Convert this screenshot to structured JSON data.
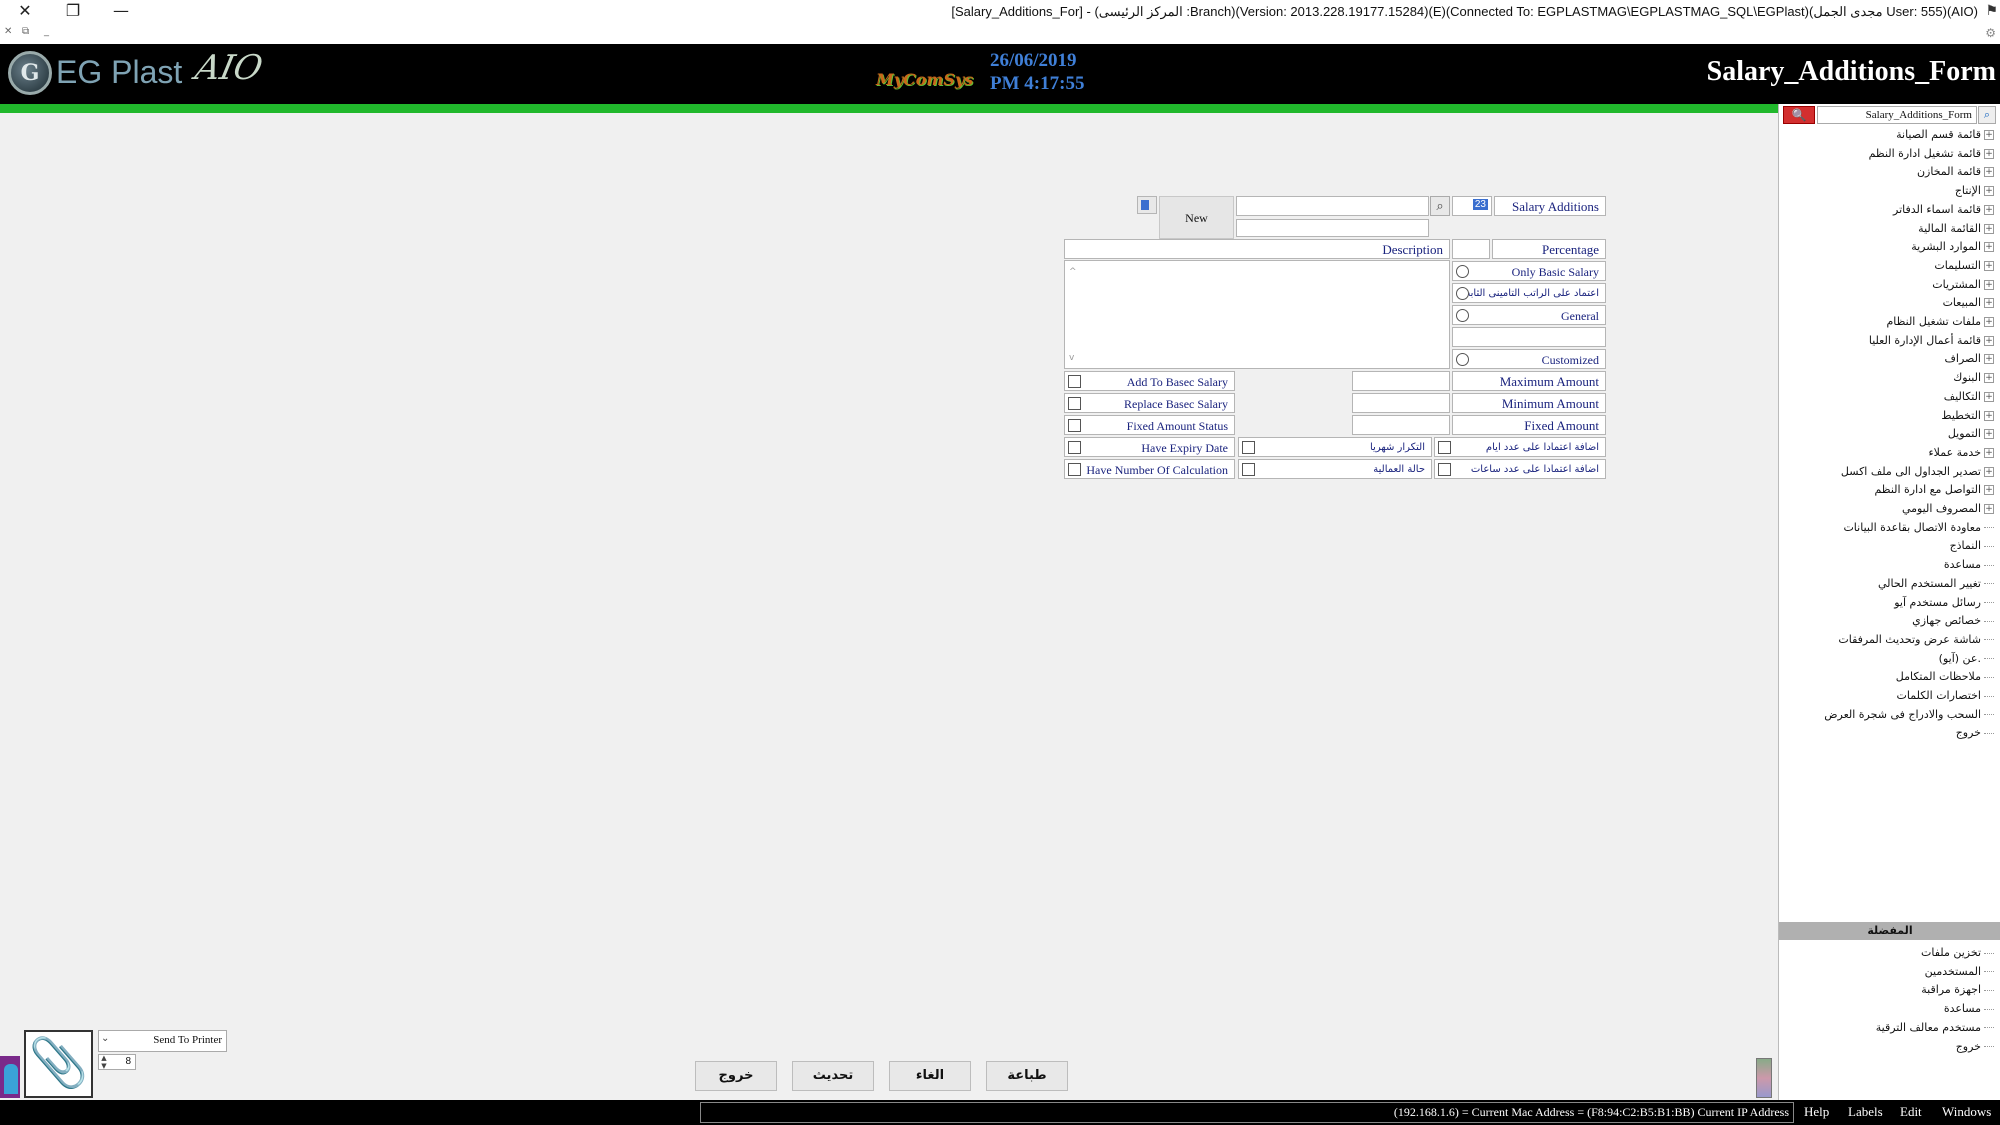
{
  "window": {
    "title": "[Salary_Additions_For] - (المركز الرئيسى :Branch)(Version: 2013.228.19177.15284)(E)(Connected To: EGPLASTMAG\\EGPLASTMAG_SQL\\EGPlast)(مجدى الجمل User: 555)(AIO)"
  },
  "header": {
    "logo_text": "EG Plast",
    "logo_suffix": "AIO",
    "vendor": "MyComSys",
    "date": "26/06/2019",
    "time": "PM 4:17:55",
    "form_title": "Salary_Additions_Form"
  },
  "form": {
    "record_label": "Salary Additions",
    "record_id": "23",
    "name_value": "",
    "name2_value": "",
    "new_button": "New",
    "percentage_label": "Percentage",
    "description_label": "Description",
    "radios": {
      "only_basic": "Only Basic Salary",
      "insurance": "اعتماد على الراتب التامينى الثابت",
      "general": "General",
      "customized": "Customized"
    },
    "amounts": {
      "maximum": "Maximum Amount",
      "minimum": "Minimum Amount",
      "fixed": "Fixed Amount"
    },
    "checks": {
      "add_to_basic": "Add To Basec Salary",
      "replace_basic": "Replace Basec Salary",
      "fixed_status": "Fixed Amount Status",
      "expiry": "Have Expiry Date",
      "num_calc": "Have Number Of Calculation",
      "monthly_repeat": "التكرار شهريا",
      "attendance": "حالة العمالية",
      "by_days": "اضافة اعتمادا على عدد ايام",
      "by_hours": "اضافة اعتمادا على عدد ساعات"
    }
  },
  "actions": {
    "print": "طباعة",
    "cancel": "الغاء",
    "update": "تحديث",
    "exit": "خروج"
  },
  "printer": {
    "mode": "Send To Printer",
    "copies": "8"
  },
  "statusbar": {
    "ip_text": "(192.168.1.6) = Current Mac Address = (F8:94:C2:B5:B1:BB) Current IP Address",
    "menus": [
      "Help",
      "Labels",
      "Edit",
      "Windows"
    ]
  },
  "right_panel": {
    "search_value": "Salary_Additions_Form",
    "tree": [
      {
        "label": "قائمة قسم الصيانة",
        "expandable": true
      },
      {
        "label": "قائمة تشغيل ادارة النظم",
        "expandable": true
      },
      {
        "label": "قائمة المخازن",
        "expandable": true
      },
      {
        "label": "الإنتاج",
        "expandable": true
      },
      {
        "label": "قائمة اسماء الدفاتر",
        "expandable": true
      },
      {
        "label": "القائمة المالية",
        "expandable": true
      },
      {
        "label": "الموارد البشرية",
        "expandable": true
      },
      {
        "label": "التسليمات",
        "expandable": true
      },
      {
        "label": "المشتريات",
        "expandable": true
      },
      {
        "label": "المبيعات",
        "expandable": true
      },
      {
        "label": "ملفات تشغيل النظام",
        "expandable": true
      },
      {
        "label": "قائمة أعمال الإدارة العليا",
        "expandable": true
      },
      {
        "label": "الصراف",
        "expandable": true
      },
      {
        "label": "البنوك",
        "expandable": true
      },
      {
        "label": "التكاليف",
        "expandable": true
      },
      {
        "label": "التخطيط",
        "expandable": true
      },
      {
        "label": "التمويل",
        "expandable": true
      },
      {
        "label": "خدمة عملاء",
        "expandable": true
      },
      {
        "label": "تصدير الجداول الى ملف اكسل",
        "expandable": true
      },
      {
        "label": "التواصل مع ادارة النظم",
        "expandable": true
      },
      {
        "label": "المصروف اليومي",
        "expandable": true
      },
      {
        "label": "معاودة الاتصال بقاعدة البيانات",
        "expandable": false
      },
      {
        "label": "النماذج",
        "expandable": false
      },
      {
        "label": "مساعدة",
        "expandable": false
      },
      {
        "label": "تغيير المستخدم الحالي",
        "expandable": false
      },
      {
        "label": "رسائل مستخدم آيو",
        "expandable": false
      },
      {
        "label": "خصائص جهازي",
        "expandable": false
      },
      {
        "label": "شاشة عرض وتحديث المرفقات",
        "expandable": false
      },
      {
        "label": "عن (آيو).",
        "expandable": false
      },
      {
        "label": "ملاحظات المتكامل",
        "expandable": false
      },
      {
        "label": "اختصارات الكلمات",
        "expandable": false
      },
      {
        "label": "السحب والادراج فى شجرة العرض",
        "expandable": false
      },
      {
        "label": "خروج",
        "expandable": false
      }
    ],
    "favorites_title": "المفضلة",
    "favorites": [
      "تخزين ملفات",
      "المستخدمين",
      "اجهزة مراقبة",
      "مساعدة",
      "مستخدم معالف الترقية",
      "خروج"
    ]
  },
  "colors": {
    "header_bg": "#000000",
    "accent_green": "#21b82c",
    "date_blue": "#3f7fd7",
    "label_blue": "#1a237e",
    "search_red": "#d32f2f"
  }
}
